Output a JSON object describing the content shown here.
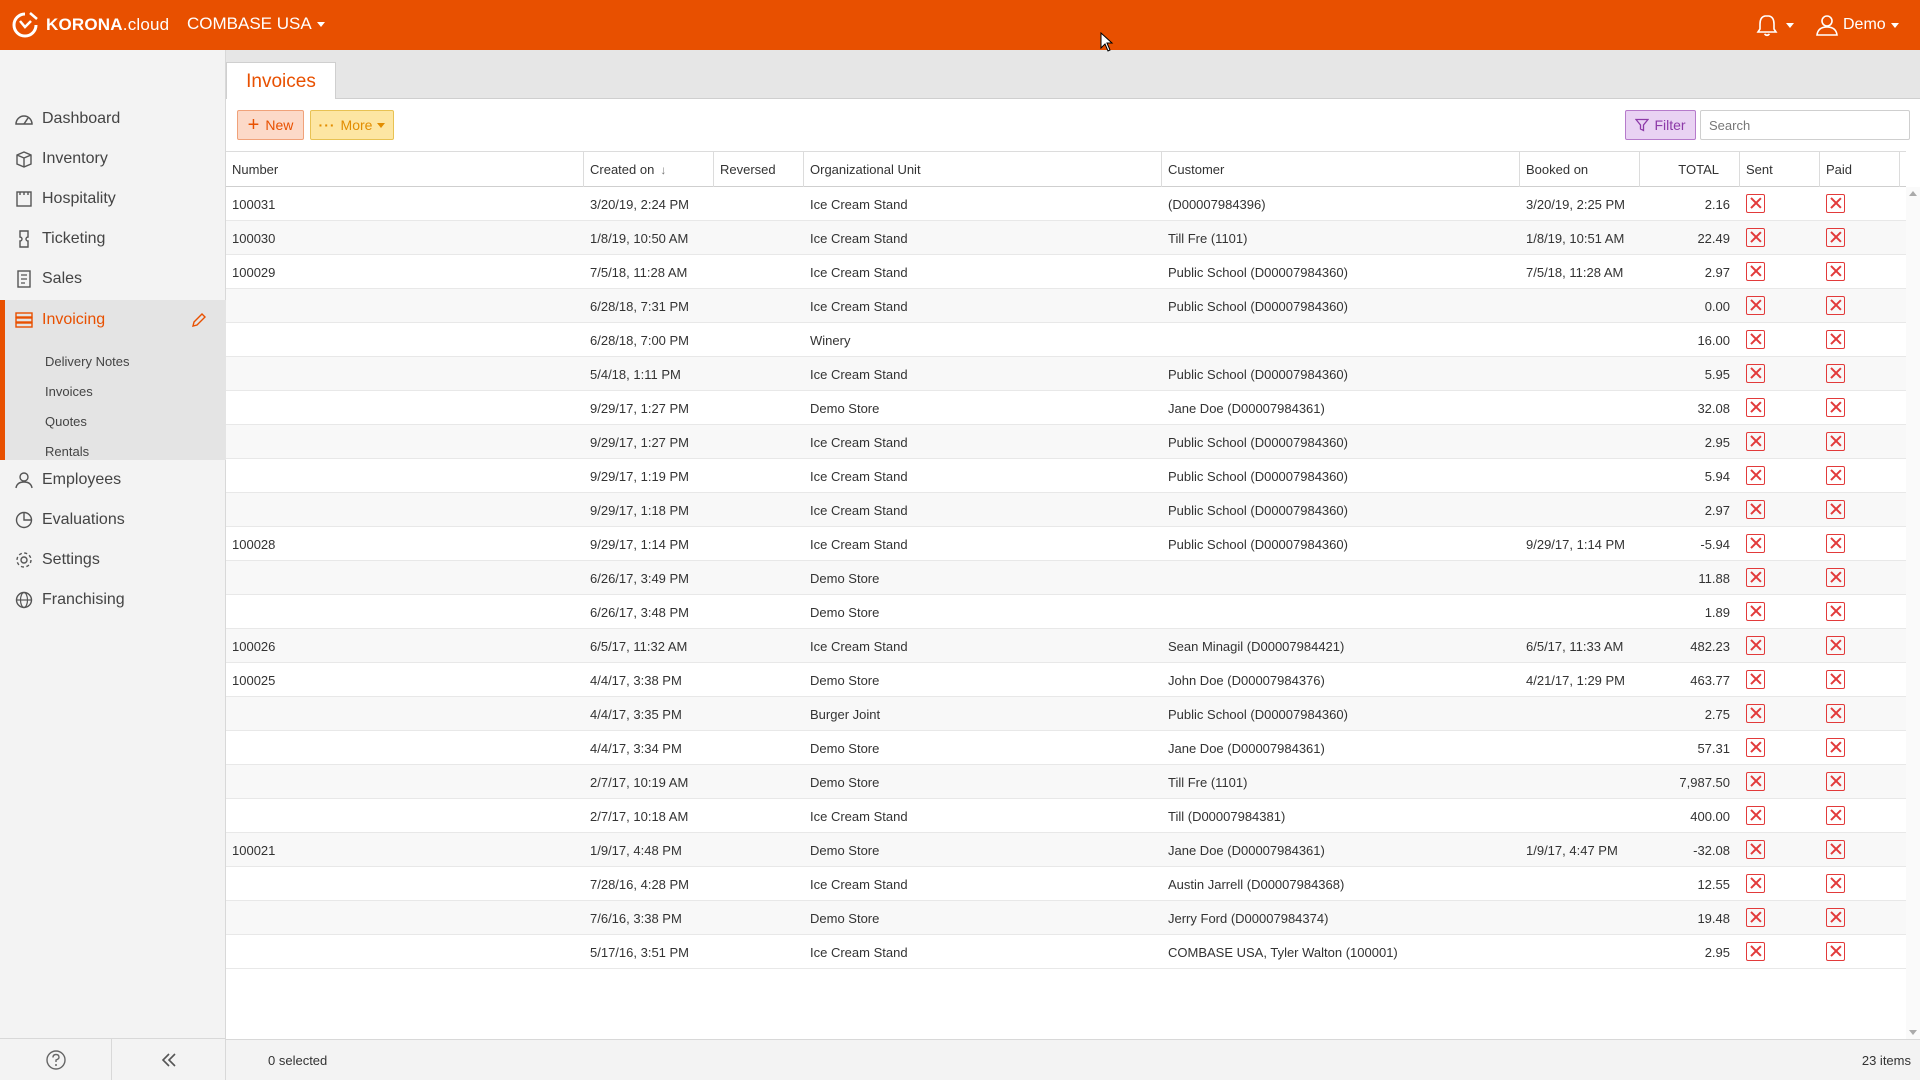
{
  "app": {
    "brand_bold": "KORONA",
    "brand_light": ".cloud",
    "company": "COMBASE USA",
    "user": "Demo"
  },
  "sidebar": {
    "items": [
      {
        "label": "Dashboard",
        "icon": "dashboard-icon"
      },
      {
        "label": "Inventory",
        "icon": "box-icon"
      },
      {
        "label": "Hospitality",
        "icon": "hospitality-icon"
      },
      {
        "label": "Ticketing",
        "icon": "ticket-icon"
      },
      {
        "label": "Sales",
        "icon": "receipt-icon"
      },
      {
        "label": "Invoicing",
        "icon": "stack-icon"
      },
      {
        "label": "Employees",
        "icon": "person-icon"
      },
      {
        "label": "Evaluations",
        "icon": "pie-chart-icon"
      },
      {
        "label": "Settings",
        "icon": "gear-icon"
      },
      {
        "label": "Franchising",
        "icon": "globe-icon"
      }
    ],
    "subitems": [
      "Delivery Notes",
      "Invoices",
      "Quotes",
      "Rentals"
    ]
  },
  "tab": {
    "label": "Invoices"
  },
  "toolbar": {
    "new_label": "New",
    "more_label": "More",
    "filter_label": "Filter",
    "search_placeholder": "Search"
  },
  "table": {
    "headers": [
      "Number",
      "Created on",
      "Reversed",
      "Organizational Unit",
      "Customer",
      "Booked on",
      "TOTAL",
      "Sent",
      "Paid"
    ],
    "rows": [
      {
        "number": "100031",
        "created": "3/20/19, 2:24 PM",
        "reversed": "",
        "org": "Ice Cream Stand",
        "customer": "(D00007984396)",
        "booked": "3/20/19, 2:25 PM",
        "total": "2.16"
      },
      {
        "number": "100030",
        "created": "1/8/19, 10:50 AM",
        "reversed": "",
        "org": "Ice Cream Stand",
        "customer": "Till Fre (1101)",
        "booked": "1/8/19, 10:51 AM",
        "total": "22.49"
      },
      {
        "number": "100029",
        "created": "7/5/18, 11:28 AM",
        "reversed": "",
        "org": "Ice Cream Stand",
        "customer": "Public School (D00007984360)",
        "booked": "7/5/18, 11:28 AM",
        "total": "2.97"
      },
      {
        "number": "",
        "created": "6/28/18, 7:31 PM",
        "reversed": "",
        "org": "Ice Cream Stand",
        "customer": "Public School (D00007984360)",
        "booked": "",
        "total": "0.00"
      },
      {
        "number": "",
        "created": "6/28/18, 7:00 PM",
        "reversed": "",
        "org": "Winery",
        "customer": "",
        "booked": "",
        "total": "16.00"
      },
      {
        "number": "",
        "created": "5/4/18, 1:11 PM",
        "reversed": "",
        "org": "Ice Cream Stand",
        "customer": "Public School (D00007984360)",
        "booked": "",
        "total": "5.95"
      },
      {
        "number": "",
        "created": "9/29/17, 1:27 PM",
        "reversed": "",
        "org": "Demo Store",
        "customer": "Jane Doe (D00007984361)",
        "booked": "",
        "total": "32.08"
      },
      {
        "number": "",
        "created": "9/29/17, 1:27 PM",
        "reversed": "",
        "org": "Ice Cream Stand",
        "customer": "Public School (D00007984360)",
        "booked": "",
        "total": "2.95"
      },
      {
        "number": "",
        "created": "9/29/17, 1:19 PM",
        "reversed": "",
        "org": "Ice Cream Stand",
        "customer": "Public School (D00007984360)",
        "booked": "",
        "total": "5.94"
      },
      {
        "number": "",
        "created": "9/29/17, 1:18 PM",
        "reversed": "",
        "org": "Ice Cream Stand",
        "customer": "Public School (D00007984360)",
        "booked": "",
        "total": "2.97"
      },
      {
        "number": "100028",
        "created": "9/29/17, 1:14 PM",
        "reversed": "",
        "org": "Ice Cream Stand",
        "customer": "Public School (D00007984360)",
        "booked": "9/29/17, 1:14 PM",
        "total": "-5.94"
      },
      {
        "number": "",
        "created": "6/26/17, 3:49 PM",
        "reversed": "",
        "org": "Demo Store",
        "customer": "",
        "booked": "",
        "total": "11.88"
      },
      {
        "number": "",
        "created": "6/26/17, 3:48 PM",
        "reversed": "",
        "org": "Demo Store",
        "customer": "",
        "booked": "",
        "total": "1.89"
      },
      {
        "number": "100026",
        "created": "6/5/17, 11:32 AM",
        "reversed": "",
        "org": "Ice Cream Stand",
        "customer": "Sean Minagil (D00007984421)",
        "booked": "6/5/17, 11:33 AM",
        "total": "482.23"
      },
      {
        "number": "100025",
        "created": "4/4/17, 3:38 PM",
        "reversed": "",
        "org": "Demo Store",
        "customer": "John Doe (D00007984376)",
        "booked": "4/21/17, 1:29 PM",
        "total": "463.77"
      },
      {
        "number": "",
        "created": "4/4/17, 3:35 PM",
        "reversed": "",
        "org": "Burger Joint",
        "customer": "Public School (D00007984360)",
        "booked": "",
        "total": "2.75"
      },
      {
        "number": "",
        "created": "4/4/17, 3:34 PM",
        "reversed": "",
        "org": "Demo Store",
        "customer": "Jane Doe (D00007984361)",
        "booked": "",
        "total": "57.31"
      },
      {
        "number": "",
        "created": "2/7/17, 10:19 AM",
        "reversed": "",
        "org": "Demo Store",
        "customer": "Till Fre (1101)",
        "booked": "",
        "total": "7,987.50"
      },
      {
        "number": "",
        "created": "2/7/17, 10:18 AM",
        "reversed": "",
        "org": "Ice Cream Stand",
        "customer": "Till (D00007984381)",
        "booked": "",
        "total": "400.00"
      },
      {
        "number": "100021",
        "created": "1/9/17, 4:48 PM",
        "reversed": "",
        "org": "Demo Store",
        "customer": "Jane Doe (D00007984361)",
        "booked": "1/9/17, 4:47 PM",
        "total": "-32.08"
      },
      {
        "number": "",
        "created": "7/28/16, 4:28 PM",
        "reversed": "",
        "org": "Ice Cream Stand",
        "customer": "Austin Jarrell (D00007984368)",
        "booked": "",
        "total": "12.55"
      },
      {
        "number": "",
        "created": "7/6/16, 3:38 PM",
        "reversed": "",
        "org": "Demo Store",
        "customer": "Jerry Ford (D00007984374)",
        "booked": "",
        "total": "19.48"
      },
      {
        "number": "",
        "created": "5/17/16, 3:51 PM",
        "reversed": "",
        "org": "Ice Cream Stand",
        "customer": "COMBASE USA, Tyler Walton (100001)",
        "booked": "",
        "total": "2.95"
      }
    ]
  },
  "footer": {
    "selected": "0 selected",
    "count": "23 items"
  },
  "colors": {
    "brand": "#e85000",
    "status_x": "#e23a3a",
    "filter": "#8d3aa8"
  }
}
